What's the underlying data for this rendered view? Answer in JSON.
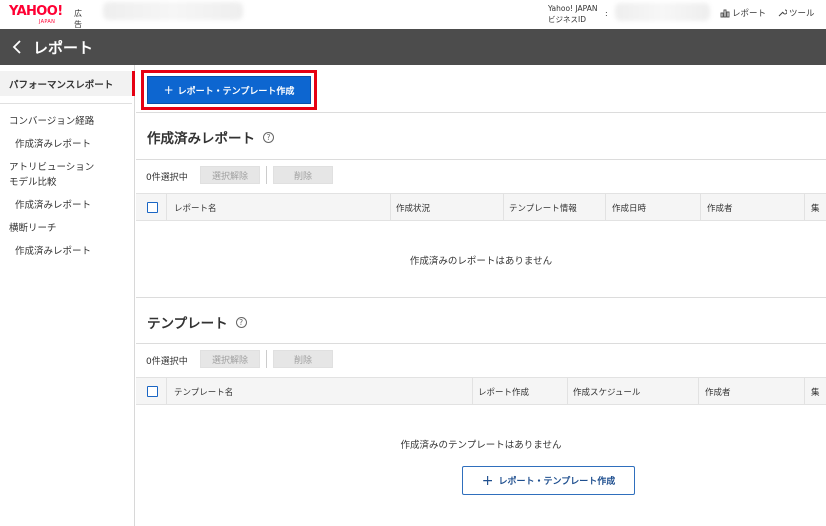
{
  "topbar": {
    "logo_text": "YAHOO!",
    "logo_sub": "JAPAN",
    "logo_ad": "広告",
    "business_id_line1": "Yahoo! JAPAN",
    "business_id_line2": "ビジネスID",
    "colon": ":",
    "report_link": "レポート",
    "tool_link": "ツール"
  },
  "header": {
    "title": "レポート"
  },
  "sidebar": {
    "items": [
      {
        "label": "パフォーマンスレポート"
      },
      {
        "label": "コンバージョン経路"
      },
      {
        "label": "作成済みレポート"
      },
      {
        "label": "アトリビューション"
      },
      {
        "label": "モデル比較"
      },
      {
        "label": "作成済みレポート"
      },
      {
        "label": "横断リーチ"
      },
      {
        "label": "作成済みレポート"
      }
    ]
  },
  "main": {
    "create_button": "レポート・テンプレート作成",
    "reports": {
      "title": "作成済みレポート",
      "selected": "0件選択中",
      "deselect": "選択解除",
      "delete": "削除",
      "columns": [
        "レポート名",
        "作成状況",
        "テンプレート情報",
        "作成日時",
        "作成者",
        "集"
      ],
      "empty": "作成済みのレポートはありません"
    },
    "templates": {
      "title": "テンプレート",
      "selected": "0件選択中",
      "deselect": "選択解除",
      "delete": "削除",
      "columns": [
        "テンプレート名",
        "レポート作成",
        "作成スケジュール",
        "作成者",
        "集"
      ],
      "empty": "作成済みのテンプレートはありません",
      "create_button": "レポート・テンプレート作成"
    }
  },
  "colors": {
    "header_bg": "#4c4c4c",
    "primary": "#0d66d0",
    "highlight": "#e60012",
    "brand": "#ff0033"
  }
}
